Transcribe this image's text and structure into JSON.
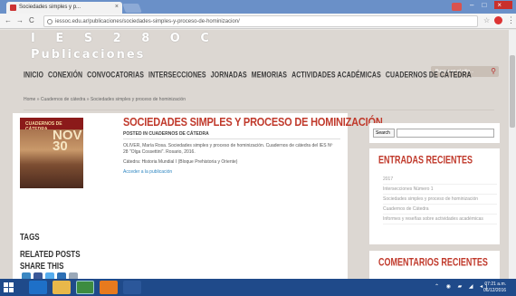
{
  "browser": {
    "tab_title": "Sociedades simples y p...",
    "url": "iessoc.edu.ar/publicaciones/sociedades-simples-y-proceso-de-hominizacion/"
  },
  "site": {
    "title": "I E S  2 8  O C",
    "subtitle": "Publicaciones",
    "nav": [
      "INICIO",
      "CONEXIÓN",
      "CONVOCATORIAS",
      "INTERSECCIONES",
      "JORNADAS",
      "MEMORIAS",
      "ACTIVIDADES ACADÉMICAS",
      "CUADERNOS DE CÁTEDRA"
    ],
    "search_placeholder": "Buscar en el sitio...",
    "breadcrumb": "Home » Cuadernos de cátedra » Sociedades simples y proceso de hominización"
  },
  "post": {
    "cover_label": "CUADERNOS DE CÁTEDRA",
    "cover_number": "NOV 30",
    "title": "SOCIEDADES SIMPLES Y PROCESO DE HOMINIZACIÓN",
    "meta": "POSTED IN CUADERNOS DE CÁTEDRA",
    "reference": "OLIVER, María Rosa. Sociedades simples y proceso de hominización. Cuadernos de cátedra del IES Nº 28 \"Olga Cossettini\". Rosario, 2016.",
    "category": "Cátedra: Historia Mundial I (Bloque Prehistoria y Oriente)",
    "link": "Acceder a la publicación",
    "tags_heading": "TAGS",
    "related_heading": "RELATED POSTS",
    "share_heading": "SHARE THIS"
  },
  "sidebar": {
    "search_button": "Search",
    "recent_heading": "ENTRADAS RECIENTES",
    "recent_items": [
      "2017",
      "Intersecciones Número 1",
      "Sociedades simples y proceso de hominización",
      "Cuadernos de Cátedra",
      "Informes y reseñas sobre actividades académicas"
    ],
    "comments_heading": "COMENTARIOS RECIENTES"
  },
  "taskbar": {
    "time": "07:21 a.m.",
    "date": "06/12/2016"
  },
  "colors": {
    "accent_red": "#c0392b",
    "taskbar": "#1f4a8a",
    "page_bg": "#dcd7d2"
  }
}
